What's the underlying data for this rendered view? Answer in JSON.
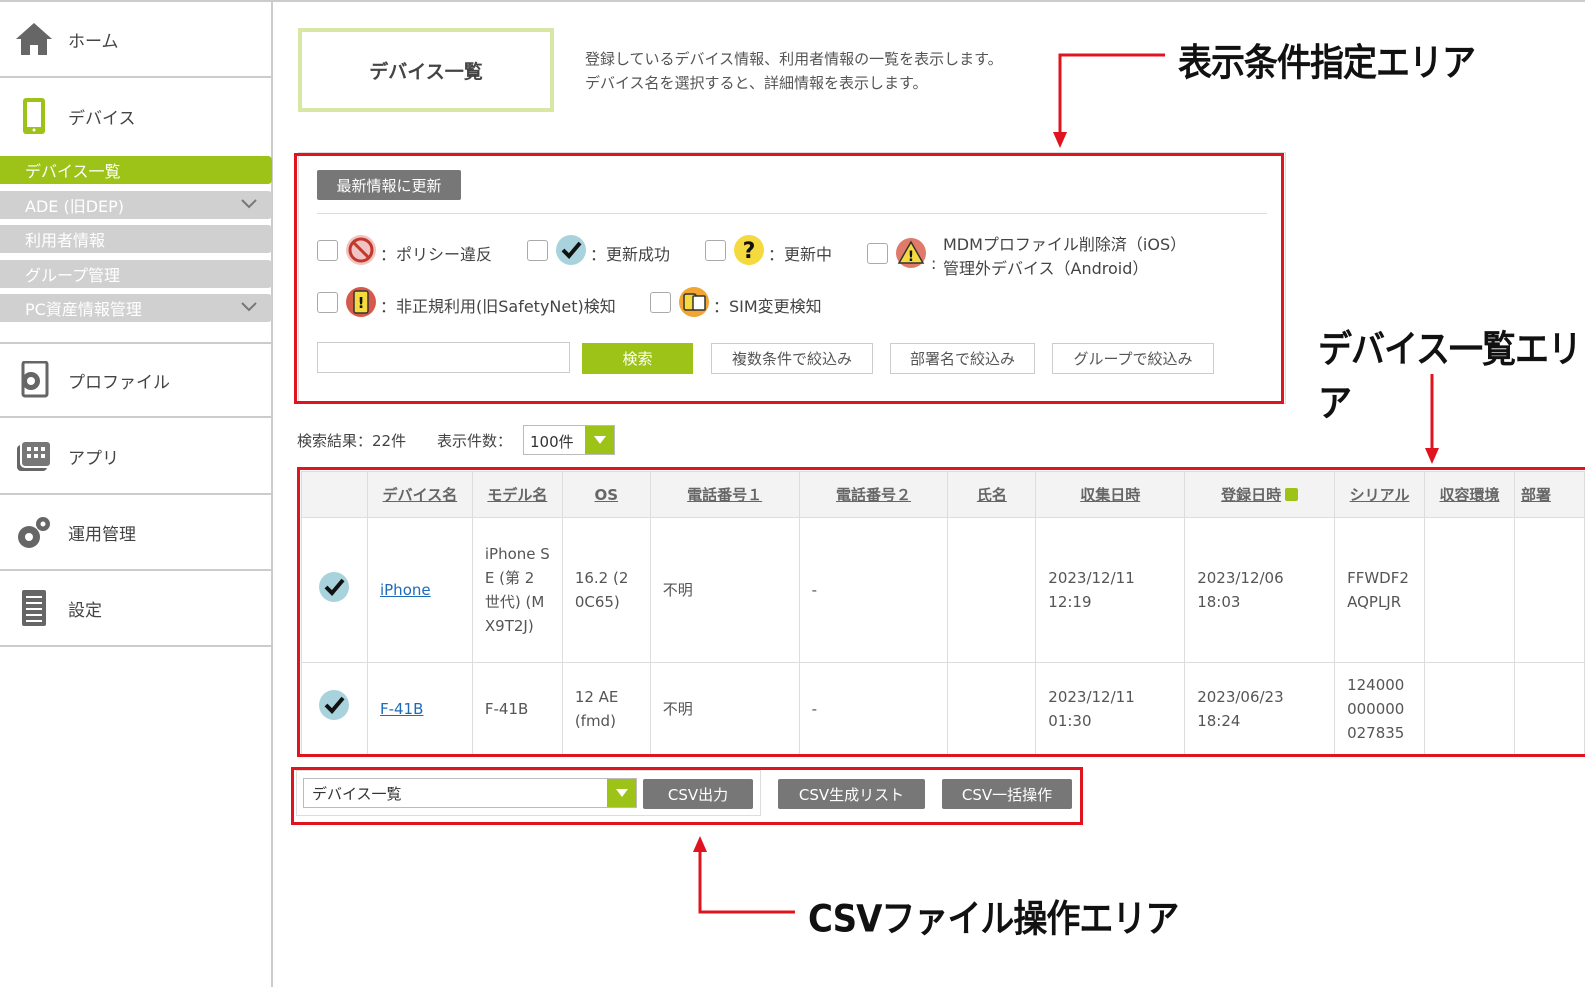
{
  "sidebar": {
    "home": "ホーム",
    "device": "デバイス",
    "sub_items": [
      {
        "label": "デバイス一覧"
      },
      {
        "label": "ADE (旧DEP)"
      },
      {
        "label": "利用者情報"
      },
      {
        "label": "グループ管理"
      },
      {
        "label": "PC資産情報管理"
      }
    ],
    "profile": "プロファイル",
    "app": "アプリ",
    "operation": "運用管理",
    "settings": "設定"
  },
  "header": {
    "title": "デバイス一覧",
    "desc_line1": "登録しているデバイス情報、利用者情報の一覧を表示します。",
    "desc_line2": "デバイス名を選択すると、詳細情報を表示します。"
  },
  "annotations": {
    "filter_area": "表示条件指定エリア",
    "list_area": "デバイス一覧エリア",
    "csv_area": "CSVファイル操作エリア"
  },
  "filters": {
    "refresh_button": "最新情報に更新",
    "legend": [
      {
        "text": "：ポリシー違反",
        "icon": "prohibited-icon"
      },
      {
        "text": "：更新成功",
        "icon": "check-icon"
      },
      {
        "text": "：更新中",
        "icon": "question-icon"
      },
      {
        "text_line1": "MDMプロファイル削除済（iOS）",
        "text_line2": "管理外デバイス（Android）",
        "icon": "warning-icon"
      },
      {
        "text": "：非正規利用(旧SafetyNet)検知",
        "icon": "alert-icon"
      },
      {
        "text": "：SIM変更検知",
        "icon": "sim-icon"
      }
    ],
    "search_placeholder": "",
    "search_button": "検索",
    "multi_filter_button": "複数条件で絞込み",
    "dept_filter_button": "部署名で絞込み",
    "group_filter_button": "グループで絞込み"
  },
  "results": {
    "count_text": "検索結果：22件",
    "pagesize_label": "表示件数：",
    "pagesize_value": "100件"
  },
  "table": {
    "columns": [
      "",
      "デバイス名",
      "モデル名",
      "OS",
      "電話番号１",
      "電話番号２",
      "氏名",
      "収集日時",
      "登録日時",
      "シリアル",
      "収容環境",
      "部署"
    ],
    "rows": [
      {
        "name": "iPhone",
        "model": "iPhone SE (第 2 世代) (MX9T2J)",
        "os": "16.2 (20C65)",
        "phone1": "不明",
        "phone2": "-",
        "user": "",
        "collected": "2023/12/11 12:19",
        "registered": "2023/12/06 18:03",
        "serial": "FFWDF2AQPLJR",
        "env": "",
        "dept": ""
      },
      {
        "name": "F-41B",
        "model": "F-41B",
        "os": "12 AE (fmd)",
        "phone1": "不明",
        "phone2": "-",
        "user": "",
        "collected": "2023/12/11 01:30",
        "registered": "2023/06/23 18:24",
        "serial": "124000000000027835",
        "env": "",
        "dept": ""
      }
    ]
  },
  "csv": {
    "select_value": "デバイス一覧",
    "export_button": "CSV出力",
    "list_button": "CSV生成リスト",
    "batch_button": "CSV一括操作"
  },
  "colors": {
    "accent": "#9dc218",
    "annotation_red": "#e0141e",
    "link": "#1d6bb8"
  }
}
